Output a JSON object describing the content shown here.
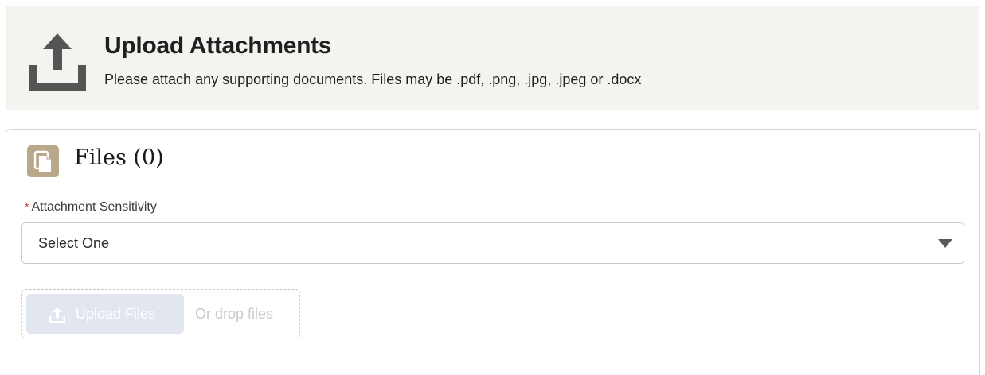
{
  "header": {
    "title": "Upload Attachments",
    "description": "Please attach any supporting documents. Files may be .pdf, .png, .jpg, .jpeg or .docx",
    "icon": "upload-icon"
  },
  "files_card": {
    "title": "Files (0)",
    "icon": "file-icon",
    "icon_color": "#baa88a"
  },
  "sensitivity_field": {
    "required_marker": "*",
    "label": "Attachment Sensitivity",
    "selected_value": "Select One",
    "required_color": "#c23934"
  },
  "upload": {
    "button_label": "Upload Files",
    "drop_text": "Or drop files",
    "button_icon": "upload-icon",
    "disabled": true
  }
}
